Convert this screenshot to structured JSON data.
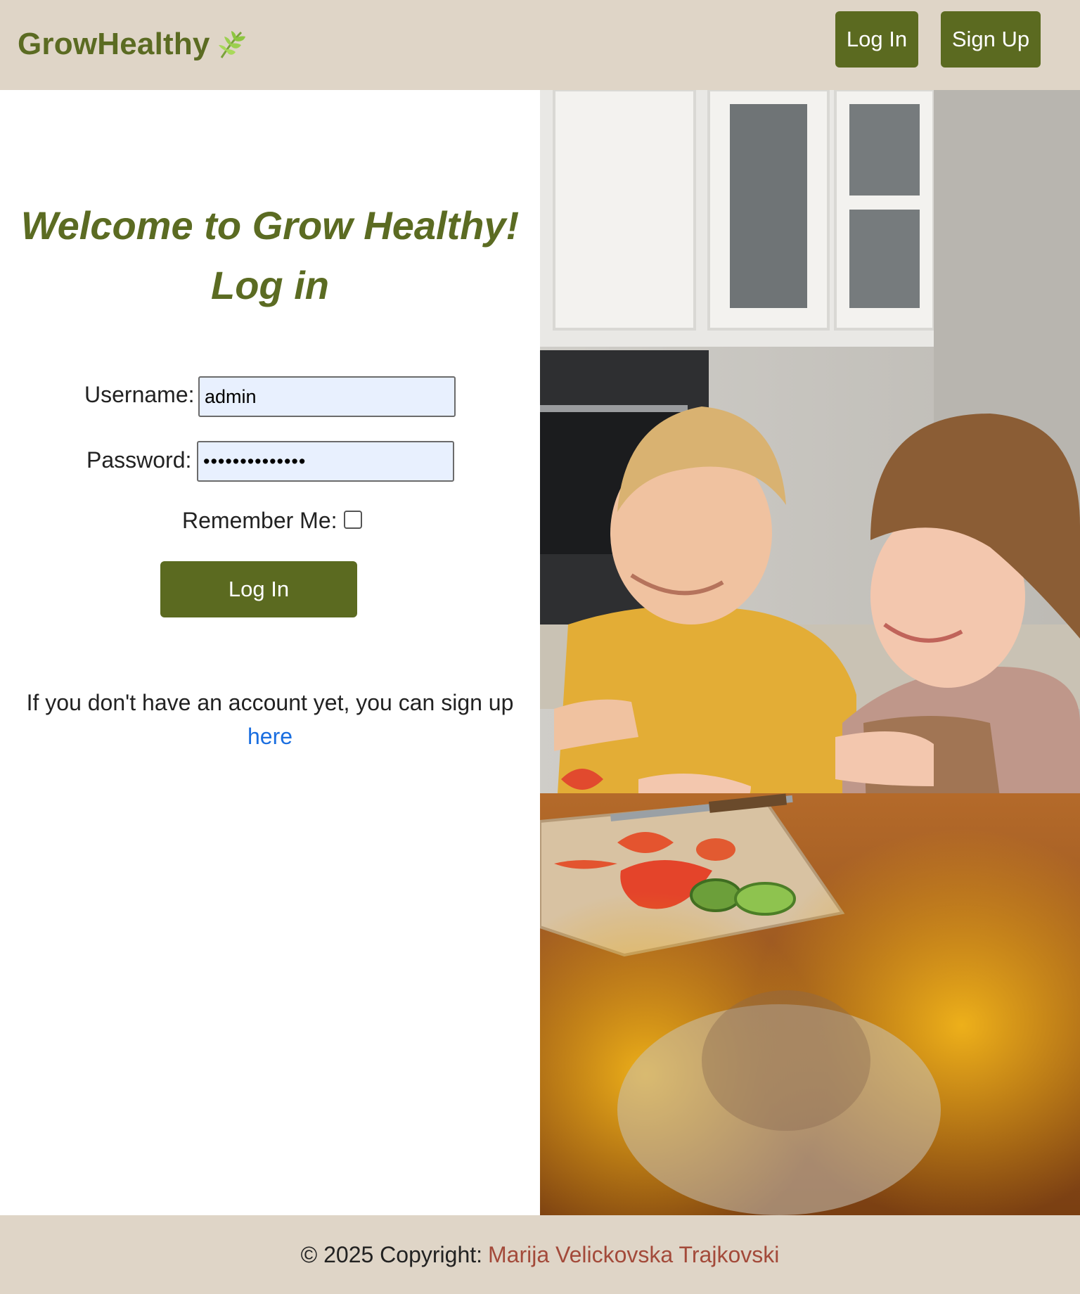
{
  "navbar": {
    "brand": "GrowHealthy",
    "brand_icon": "leaf-icon",
    "login_label": "Log In",
    "signup_label": "Sign Up",
    "background": "#dfd5c7",
    "button_color": "#5b6a20"
  },
  "login": {
    "title_line1": "Welcome to Grow Healthy!",
    "title_line2": "Log in",
    "username_label": "Username:",
    "username_value": "admin",
    "password_label": "Password:",
    "password_value": "••••••••••••••",
    "remember_label": "Remember Me:",
    "remember_checked": false,
    "submit_label": "Log In",
    "signup_prompt": "If you don't have an account yet, you can sign up",
    "signup_link": "here"
  },
  "hero_image": {
    "description": "children-cooking-vegetables-photo"
  },
  "footer": {
    "copyright": "© 2025 Copyright:",
    "author": "Marija Velickovska Trajkovski"
  }
}
